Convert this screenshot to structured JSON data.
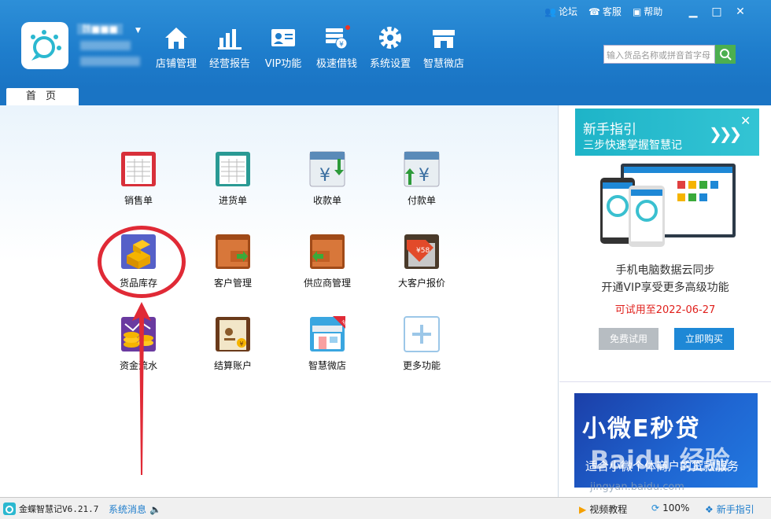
{
  "app": {
    "user_name": "魏■■■",
    "top_links": [
      {
        "label": "论坛",
        "icon": "people-icon"
      },
      {
        "label": "客服",
        "icon": "support-icon"
      },
      {
        "label": "帮助",
        "icon": "help-book-icon"
      }
    ],
    "window_buttons": [
      "minimize",
      "maximize",
      "close"
    ]
  },
  "nav": [
    {
      "label": "店铺管理",
      "icon": "house-icon"
    },
    {
      "label": "经营报告",
      "icon": "bar-chart-icon"
    },
    {
      "label": "VIP功能",
      "icon": "vip-card-icon"
    },
    {
      "label": "极速借钱",
      "icon": "coin-stack-icon"
    },
    {
      "label": "系统设置",
      "icon": "gear-icon"
    },
    {
      "label": "智慧微店",
      "icon": "store-icon"
    }
  ],
  "search": {
    "placeholder": "输入货品名称或拼音首字母"
  },
  "tabs": [
    {
      "label": "首 页"
    }
  ],
  "tiles": [
    {
      "label": "销售单",
      "icon": "sales-order-icon"
    },
    {
      "label": "进货单",
      "icon": "purchase-order-icon"
    },
    {
      "label": "收款单",
      "icon": "receipt-icon"
    },
    {
      "label": "付款单",
      "icon": "payment-icon"
    },
    {
      "label": "货品库存",
      "icon": "inventory-icon"
    },
    {
      "label": "客户管理",
      "icon": "customer-folder-icon"
    },
    {
      "label": "供应商管理",
      "icon": "supplier-folder-icon"
    },
    {
      "label": "大客户报价",
      "icon": "price-tag-icon"
    },
    {
      "label": "资金流水",
      "icon": "cash-flow-icon"
    },
    {
      "label": "结算账户",
      "icon": "account-book-icon"
    },
    {
      "label": "智慧微店",
      "icon": "micro-store-icon"
    },
    {
      "label": "更多功能",
      "icon": "plus-icon"
    }
  ],
  "side": {
    "guide_title": "新手指引",
    "guide_subtitle": "三步快速掌握智慧记",
    "promo_line1": "手机电脑数据云同步",
    "promo_line2": "开通VIP享受更多高级功能",
    "trial_text": "可试用至2022-06-27",
    "free_trial_btn": "免费试用",
    "buy_btn": "立即购买",
    "ad_title": "小微E秒贷",
    "ad_subtitle": "适合小微个体商户的贷款服务"
  },
  "status": {
    "version": "金蝶智慧记V6.21.7",
    "messages": "系统消息",
    "video": "视频教程",
    "zoom": "100%",
    "guide": "新手指引"
  },
  "watermark": {
    "brand": "Baidu 经验",
    "url": "jingyan.baidu.com"
  },
  "colors": {
    "titlebar": "#1e7dcc",
    "accent": "#1e88d6",
    "annotation": "#e02a36",
    "trial": "#e0201c"
  }
}
